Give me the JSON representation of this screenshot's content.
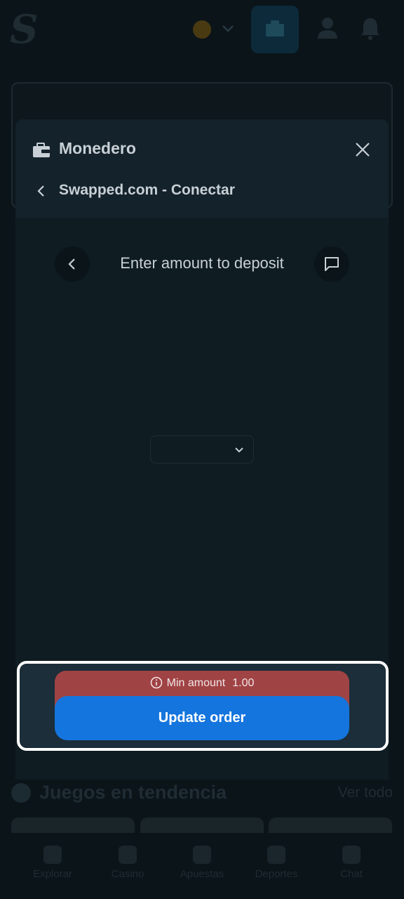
{
  "header": {
    "logo_letter": "S",
    "icons": [
      "coin-icon",
      "chevron-down-icon",
      "wallet-icon",
      "user-icon",
      "bell-icon"
    ]
  },
  "modal": {
    "title": "Monedero",
    "subtitle": "Swapped.com - Conectar",
    "inner_title": "Enter amount to deposit",
    "currency_value": ""
  },
  "footer": {
    "warning_label": "Min amount",
    "warning_value": "1.00",
    "update_button": "Update order"
  },
  "trending": {
    "title": "Juegos en tendencia",
    "link": "Ver todo"
  },
  "bottom_nav": [
    {
      "label": "Explorar",
      "icon": "explore-icon"
    },
    {
      "label": "Casino",
      "icon": "casino-icon"
    },
    {
      "label": "Apuestas",
      "icon": "bets-icon"
    },
    {
      "label": "Deportes",
      "icon": "sports-icon"
    },
    {
      "label": "Chat",
      "icon": "chat-icon"
    }
  ],
  "colors": {
    "accent": "#1475de",
    "warning": "#a04345",
    "modal_bg": "#13222b",
    "page_bg": "#0b1419"
  }
}
